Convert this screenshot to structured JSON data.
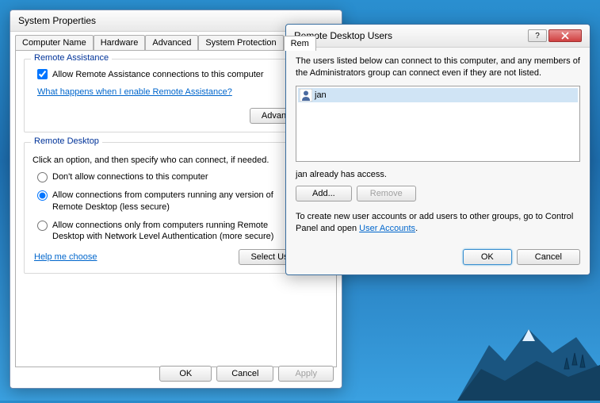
{
  "sysprops": {
    "title": "System Properties",
    "tabs": [
      "Computer Name",
      "Hardware",
      "Advanced",
      "System Protection",
      "Remote"
    ],
    "active_tab_partial": "Rem",
    "remote_assistance": {
      "group_title": "Remote Assistance",
      "checkbox_label": "Allow Remote Assistance connections to this computer",
      "checkbox_checked": true,
      "help_link": "What happens when I enable Remote Assistance?",
      "advanced_btn": "Advanced..."
    },
    "remote_desktop": {
      "group_title": "Remote Desktop",
      "instruction": "Click an option, and then specify who can connect, if needed.",
      "options": [
        "Don't allow connections to this computer",
        "Allow connections from computers running any version of Remote Desktop (less secure)",
        "Allow connections only from computers running Remote Desktop with Network Level Authentication (more secure)"
      ],
      "selected_index": 1,
      "help_link": "Help me choose",
      "select_users_btn": "Select Users..."
    },
    "buttons": {
      "ok": "OK",
      "cancel": "Cancel",
      "apply": "Apply"
    }
  },
  "rdu": {
    "title": "Remote Desktop Users",
    "description": "The users listed below can connect to this computer, and any members of the Administrators group can connect even if they are not listed.",
    "users": [
      "jan"
    ],
    "status": "jan already has access.",
    "add_btn": "Add...",
    "remove_btn": "Remove",
    "hint_pre": "To create new user accounts or add users to other groups, go to Control Panel and open ",
    "hint_link": "User Accounts",
    "hint_post": ".",
    "ok": "OK",
    "cancel": "Cancel"
  }
}
